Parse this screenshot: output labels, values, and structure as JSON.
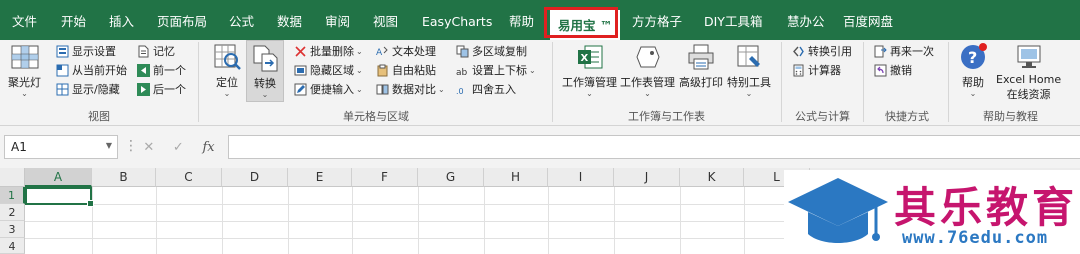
{
  "menu": {
    "tabs": [
      "文件",
      "开始",
      "插入",
      "页面布局",
      "公式",
      "数据",
      "审阅",
      "视图",
      "EasyCharts",
      "帮助",
      "易用宝 ™",
      "方方格子",
      "DIY工具箱",
      "慧办公",
      "百度网盘"
    ],
    "active_tab": "易用宝 ™"
  },
  "ribbon": {
    "view": {
      "spotlight": "聚光灯",
      "show_settings": "显示设置",
      "from_current": "从当前开始",
      "show_hide": "显示/隐藏",
      "remember": "记忆",
      "prev": "前一个",
      "next": "后一个",
      "label": "视图"
    },
    "cells": {
      "locate": "定位",
      "convert": "转换",
      "batch_delete": "批量删除",
      "hide_area": "隐藏区域",
      "quick_input": "便捷输入",
      "text_process": "文本处理",
      "free_paste": "自由粘贴",
      "data_compare": "数据对比",
      "multi_copy": "多区域复制",
      "sub_sup": "设置上下标",
      "round": "四舍五入",
      "label": "单元格与区域"
    },
    "workbook": {
      "wb_manage": "工作簿管理",
      "ws_manage": "工作表管理",
      "adv_print": "高级打印",
      "special_tools": "特别工具",
      "label": "工作簿与工作表"
    },
    "formula": {
      "convert_ref": "转换引用",
      "calculator": "计算器",
      "label": "公式与计算"
    },
    "quick": {
      "again": "再来一次",
      "undo": "撤销",
      "label": "快捷方式"
    },
    "help": {
      "help": "帮助",
      "home": "Excel Home",
      "online": "在线资源",
      "label": "帮助与教程"
    }
  },
  "formula_bar": {
    "name_box": "A1",
    "cancel_icon": "✕",
    "enter_icon": "✓",
    "fx": "fx",
    "content": ""
  },
  "grid": {
    "columns": [
      "A",
      "B",
      "C",
      "D",
      "E",
      "F",
      "G",
      "H",
      "I",
      "J",
      "K",
      "L"
    ],
    "rows": [
      "1",
      "2",
      "3",
      "4"
    ],
    "selected_cell": "A1"
  },
  "watermark": {
    "title": "其乐教育",
    "url": "www.76edu.com"
  },
  "colors": {
    "excel_green": "#217346",
    "highlight_red": "#e02020",
    "watermark_pink": "#c6156e",
    "watermark_blue": "#2b78c2"
  }
}
